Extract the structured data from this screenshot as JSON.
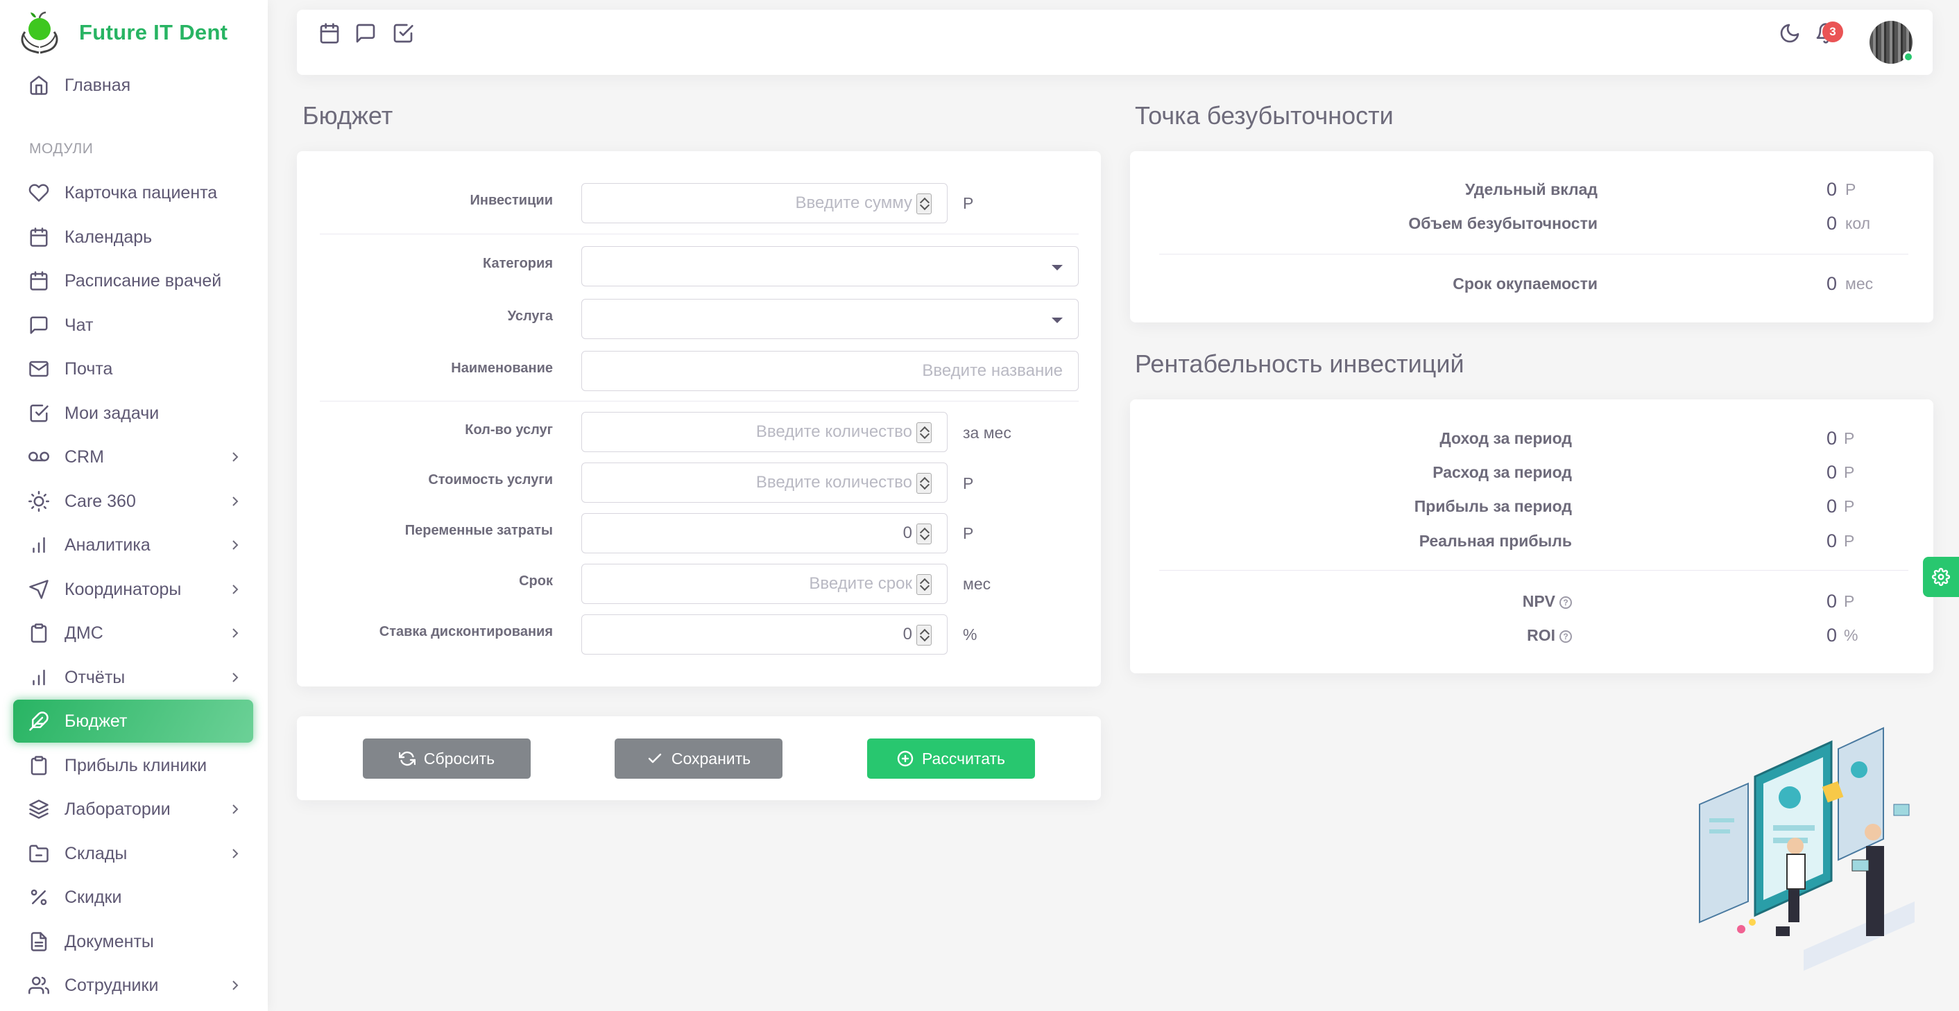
{
  "brand": {
    "name": "Future IT Dent"
  },
  "sidebar": {
    "home": "Главная",
    "section_header": "МОДУЛИ",
    "items": [
      {
        "label": "Карточка пациента",
        "icon": "heart-icon",
        "has_children": false
      },
      {
        "label": "Календарь",
        "icon": "calendar-icon",
        "has_children": false
      },
      {
        "label": "Расписание врачей",
        "icon": "calendar-icon",
        "has_children": false
      },
      {
        "label": "Чат",
        "icon": "chat-icon",
        "has_children": false
      },
      {
        "label": "Почта",
        "icon": "mail-icon",
        "has_children": false
      },
      {
        "label": "Мои задачи",
        "icon": "check-square-icon",
        "has_children": false
      },
      {
        "label": "CRM",
        "icon": "voicemail-icon",
        "has_children": true
      },
      {
        "label": "Care 360",
        "icon": "sun-icon",
        "has_children": true
      },
      {
        "label": "Аналитика",
        "icon": "bar-chart-icon",
        "has_children": true
      },
      {
        "label": "Координаторы",
        "icon": "navigation-icon",
        "has_children": true
      },
      {
        "label": "ДМС",
        "icon": "clipboard-icon",
        "has_children": true
      },
      {
        "label": "Отчёты",
        "icon": "bar-chart-icon",
        "has_children": true
      },
      {
        "label": "Бюджет",
        "icon": "feather-icon",
        "has_children": false,
        "active": true
      },
      {
        "label": "Прибыль клиники",
        "icon": "clipboard-icon",
        "has_children": false
      },
      {
        "label": "Лаборатории",
        "icon": "layers-icon",
        "has_children": true
      },
      {
        "label": "Склады",
        "icon": "folder-minus-icon",
        "has_children": true
      },
      {
        "label": "Скидки",
        "icon": "percent-icon",
        "has_children": false
      },
      {
        "label": "Документы",
        "icon": "file-text-icon",
        "has_children": false
      },
      {
        "label": "Сотрудники",
        "icon": "users-icon",
        "has_children": true
      }
    ]
  },
  "topbar": {
    "notifications_count": "3"
  },
  "budget": {
    "title": "Бюджет",
    "fields": {
      "investments": {
        "label": "Инвестиции",
        "placeholder": "Введите сумму",
        "unit": "Р"
      },
      "category": {
        "label": "Категория"
      },
      "service": {
        "label": "Услуга"
      },
      "name": {
        "label": "Наименование",
        "placeholder": "Введите название"
      },
      "service_count": {
        "label": "Кол-во услуг",
        "placeholder": "Введите количество",
        "unit": "за мес"
      },
      "service_cost": {
        "label": "Стоимость услуги",
        "placeholder": "Введите количество",
        "unit": "Р"
      },
      "variable_costs": {
        "label": "Переменные затраты",
        "value": "0",
        "unit": "Р"
      },
      "term": {
        "label": "Срок",
        "placeholder": "Введите срок",
        "unit": "мес"
      },
      "discount_rate": {
        "label": "Ставка дисконтирования",
        "value": "0",
        "unit": "%"
      }
    },
    "buttons": {
      "reset": "Сбросить",
      "save": "Сохранить",
      "calculate": "Рассчитать"
    }
  },
  "breakeven": {
    "title": "Точка безубыточности",
    "rows": [
      {
        "label": "Удельный вклад",
        "value": "0",
        "unit": "Р"
      },
      {
        "label": "Объем безубыточности",
        "value": "0",
        "unit": "кол"
      },
      {
        "label": "Срок окупаемости",
        "value": "0",
        "unit": "мес"
      }
    ]
  },
  "roi": {
    "title": "Рентабельность инвестиций",
    "rows": [
      {
        "label": "Доход за период",
        "value": "0",
        "unit": "Р"
      },
      {
        "label": "Расход за период",
        "value": "0",
        "unit": "Р"
      },
      {
        "label": "Прибыль за период",
        "value": "0",
        "unit": "Р"
      },
      {
        "label": "Реальная прибыль",
        "value": "0",
        "unit": "Р"
      },
      {
        "label": "NPV",
        "value": "0",
        "unit": "Р"
      },
      {
        "label": "ROI",
        "value": "0",
        "unit": "%"
      }
    ]
  },
  "colors": {
    "accent": "#28b463",
    "button_gray": "#82868b",
    "button_green": "#28c76f",
    "badge": "#ea5455"
  }
}
